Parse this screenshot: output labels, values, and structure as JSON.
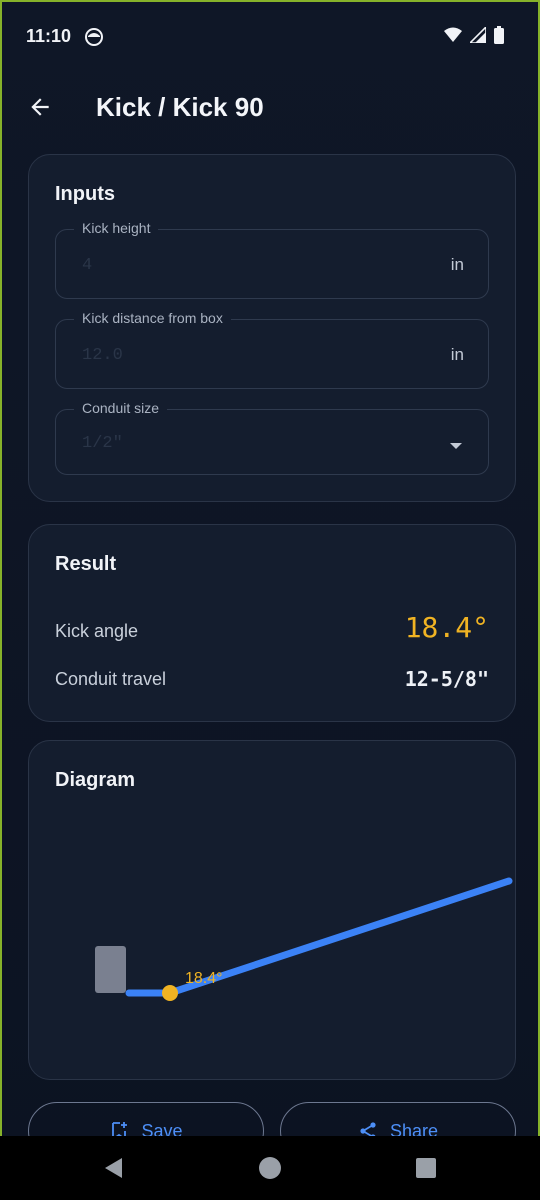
{
  "status_bar": {
    "time": "11:10"
  },
  "app_bar": {
    "title": "Kick / Kick 90"
  },
  "inputs": {
    "title": "Inputs",
    "kick_height": {
      "label": "Kick height",
      "value": "4",
      "unit": "in"
    },
    "kick_distance": {
      "label": "Kick distance from box",
      "value": "12.0",
      "unit": "in"
    },
    "conduit_size": {
      "label": "Conduit size",
      "value": "1/2\""
    }
  },
  "result": {
    "title": "Result",
    "kick_angle": {
      "label": "Kick angle",
      "value": "18.4°"
    },
    "conduit_travel": {
      "label": "Conduit travel",
      "value": "12-5/8\""
    }
  },
  "diagram": {
    "title": "Diagram",
    "angle_label": "18.4°",
    "angle_deg": 18.4
  },
  "actions": {
    "save_label": "Save",
    "share_label": "Share"
  },
  "colors": {
    "accent_blue": "#3b82f6",
    "angle_yellow": "#f0b323",
    "box_gray": "#7a8090",
    "card_bg": "#141d2e"
  }
}
